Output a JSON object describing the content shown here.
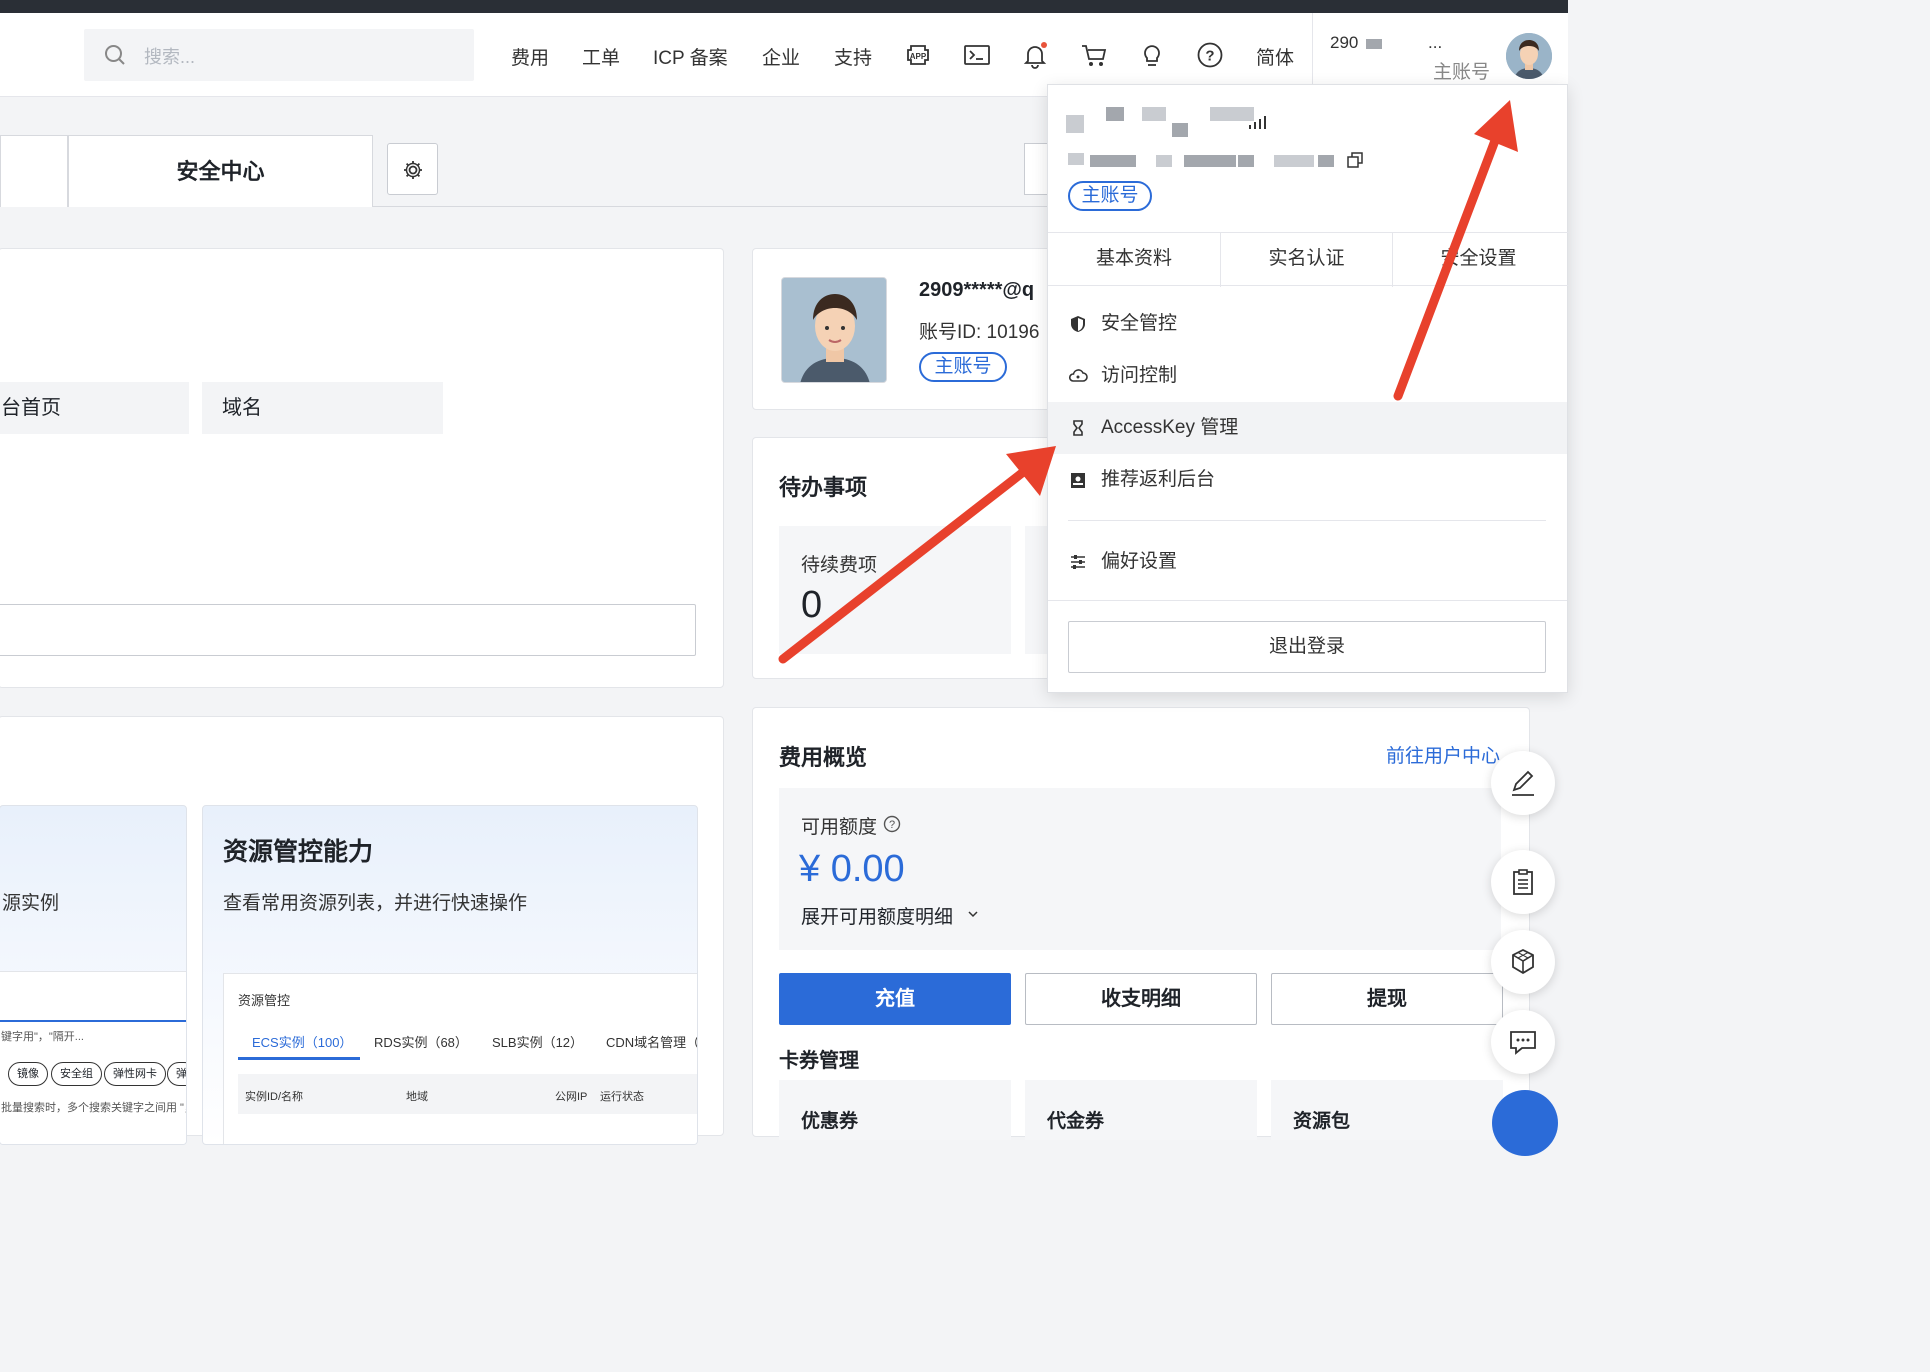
{
  "topbar": {
    "search_placeholder": "搜索...",
    "nav": [
      "费用",
      "工单",
      "ICP 备案",
      "企业",
      "支持"
    ],
    "icons": [
      "app-icon",
      "terminal-icon",
      "bell-icon",
      "cart-icon",
      "bulb-icon",
      "help-icon"
    ],
    "language": "简体",
    "account_id_partial": "290",
    "account_name_partial": "...",
    "account_role": "主账号"
  },
  "tabs": {
    "active_label": "安全中心"
  },
  "quick_links": [
    "台首页",
    "域名"
  ],
  "features": [
    {
      "title": "",
      "desc": "源实例"
    },
    {
      "title": "资源管控能力",
      "desc": "查看常用资源列表，并进行快速操作"
    }
  ],
  "resource_panel": {
    "title": "资源管控",
    "tabs": [
      "ECS实例（100）",
      "RDS实例（68）",
      "SLB实例（12）",
      "CDN域名管理（2"
    ],
    "columns": [
      "实例ID/名称",
      "地域",
      "公网IP",
      "运行状态"
    ],
    "left_hint": "键字用\"，\"隔开...",
    "left_pills": [
      "镜像",
      "安全组",
      "弹性网卡",
      "弹"
    ],
    "left_footer": "批量搜索时，多个搜索关键字之间用 \"，\""
  },
  "profile": {
    "email": "2909*****@q",
    "account_id": "账号ID: 10196",
    "badge": "主账号"
  },
  "todo": {
    "title": "待办事项",
    "items": [
      {
        "label": "待续费项",
        "value": "0"
      }
    ]
  },
  "fees": {
    "title": "费用概览",
    "link": "前往用户中心",
    "available_label": "可用额度",
    "amount": "¥ 0.00",
    "expand": "展开可用额度明细",
    "buttons": [
      "充值",
      "收支明细",
      "提现"
    ],
    "coupon_title": "卡券管理",
    "coupons": [
      "优惠券",
      "代金券",
      "资源包"
    ]
  },
  "dropdown": {
    "badge": "主账号",
    "tabs": [
      "基本资料",
      "实名认证",
      "安全设置"
    ],
    "items": [
      {
        "icon": "shield-icon",
        "label": "安全管控"
      },
      {
        "icon": "cloud-icon",
        "label": "访问控制"
      },
      {
        "icon": "key-icon",
        "label": "AccessKey 管理"
      },
      {
        "icon": "gift-icon",
        "label": "推荐返利后台"
      }
    ],
    "preferences": {
      "icon": "sliders-icon",
      "label": "偏好设置"
    },
    "logout": "退出登录"
  },
  "colors": {
    "accent": "#2b6bd8",
    "annotation_arrow": "#e8412c"
  }
}
